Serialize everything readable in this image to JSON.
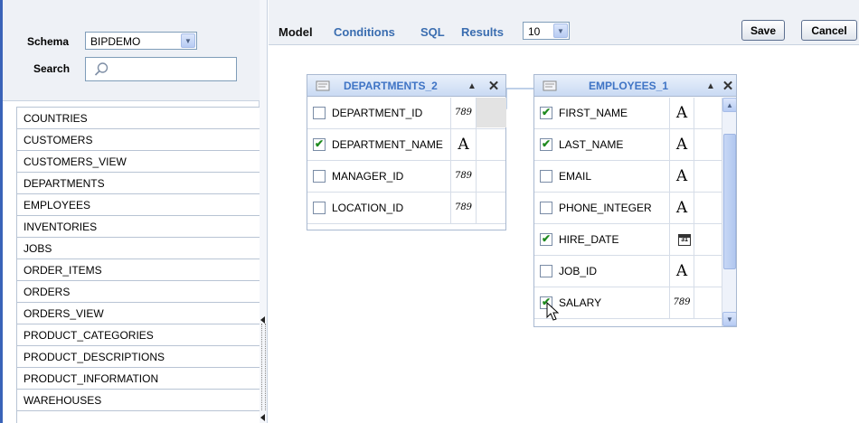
{
  "left_panel": {
    "schema_label": "Schema",
    "schema_value": "BIPDEMO",
    "search_label": "Search",
    "tables": [
      "COUNTRIES",
      "CUSTOMERS",
      "CUSTOMERS_VIEW",
      "DEPARTMENTS",
      "EMPLOYEES",
      "INVENTORIES",
      "JOBS",
      "ORDER_ITEMS",
      "ORDERS",
      "ORDERS_VIEW",
      "PRODUCT_CATEGORIES",
      "PRODUCT_DESCRIPTIONS",
      "PRODUCT_INFORMATION",
      "WAREHOUSES"
    ]
  },
  "toolbar": {
    "tabs": [
      "Model",
      "Conditions",
      "SQL",
      "Results"
    ],
    "results_value": "10",
    "save_label": "Save",
    "cancel_label": "Cancel"
  },
  "type_labels": {
    "number": "789",
    "date": "31"
  },
  "departments": {
    "title": "DEPARTMENTS_2",
    "columns": [
      {
        "name": "DEPARTMENT_ID",
        "checked": false,
        "type": "number"
      },
      {
        "name": "DEPARTMENT_NAME",
        "checked": true,
        "type": "text"
      },
      {
        "name": "MANAGER_ID",
        "checked": false,
        "type": "number"
      },
      {
        "name": "LOCATION_ID",
        "checked": false,
        "type": "number"
      }
    ]
  },
  "employees": {
    "title": "EMPLOYEES_1",
    "columns": [
      {
        "name": "FIRST_NAME",
        "checked": true,
        "type": "text"
      },
      {
        "name": "LAST_NAME",
        "checked": true,
        "type": "text"
      },
      {
        "name": "EMAIL",
        "checked": false,
        "type": "text"
      },
      {
        "name": "PHONE_INTEGER",
        "checked": false,
        "type": "text"
      },
      {
        "name": "HIRE_DATE",
        "checked": true,
        "type": "date"
      },
      {
        "name": "JOB_ID",
        "checked": false,
        "type": "text"
      },
      {
        "name": "SALARY",
        "checked": true,
        "type": "number"
      }
    ]
  },
  "colors": {
    "accent": "#3a63b8",
    "link": "#3a6db0",
    "table_title": "#3f74c5",
    "check": "#1f8a1f"
  }
}
